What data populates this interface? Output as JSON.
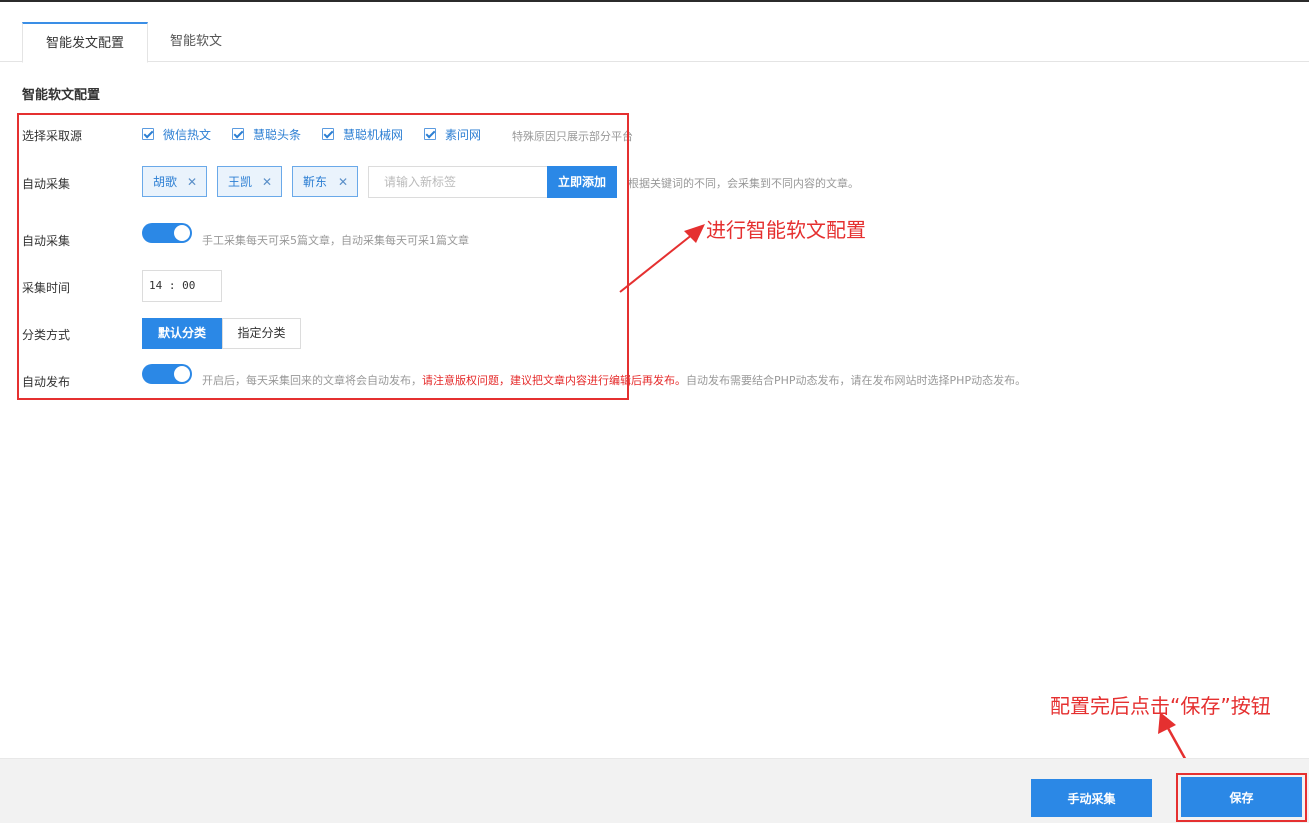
{
  "tabs": [
    {
      "label": "智能发文配置",
      "active": true
    },
    {
      "label": "智能软文",
      "active": false
    }
  ],
  "section_title": "智能软文配置",
  "rows": {
    "source_label": "选择采取源",
    "sources": [
      "微信热文",
      "慧聪头条",
      "慧聪机械网",
      "素问网"
    ],
    "source_hint": "特殊原因只展示部分平台",
    "auto_collect_label": "自动采集",
    "tags": [
      "胡歌",
      "王凯",
      "靳东"
    ],
    "tag_input_placeholder": "请输入新标签",
    "add_button": "立即添加",
    "tag_hint": "根据关键词的不同，会采集到不同内容的文章。",
    "auto_collect2_label": "自动采集",
    "auto_collect_hint": "手工采集每天可采5篇文章，自动采集每天可采1篇文章",
    "time_label": "采集时间",
    "time_value": "14 : 00",
    "category_label": "分类方式",
    "category_default": "默认分类",
    "category_custom": "指定分类",
    "publish_label": "自动发布",
    "publish_hint_1": "开启后，每天采集回来的文章将会自动发布，",
    "publish_hint_red": "请注意版权问题，建议把文章内容进行编辑后再发布。",
    "publish_hint_2": "自动发布需要结合PHP动态发布，请在发布网站时选择PHP动态发布。"
  },
  "annotations": {
    "config_note": "进行智能软文配置",
    "save_note": "配置完后点击“保存”按钮",
    "color": "#e53030"
  },
  "footer": {
    "manual_button": "手动采集",
    "save_button": "保存"
  },
  "colors": {
    "primary": "#2b88e6",
    "annotation": "#e53030"
  }
}
